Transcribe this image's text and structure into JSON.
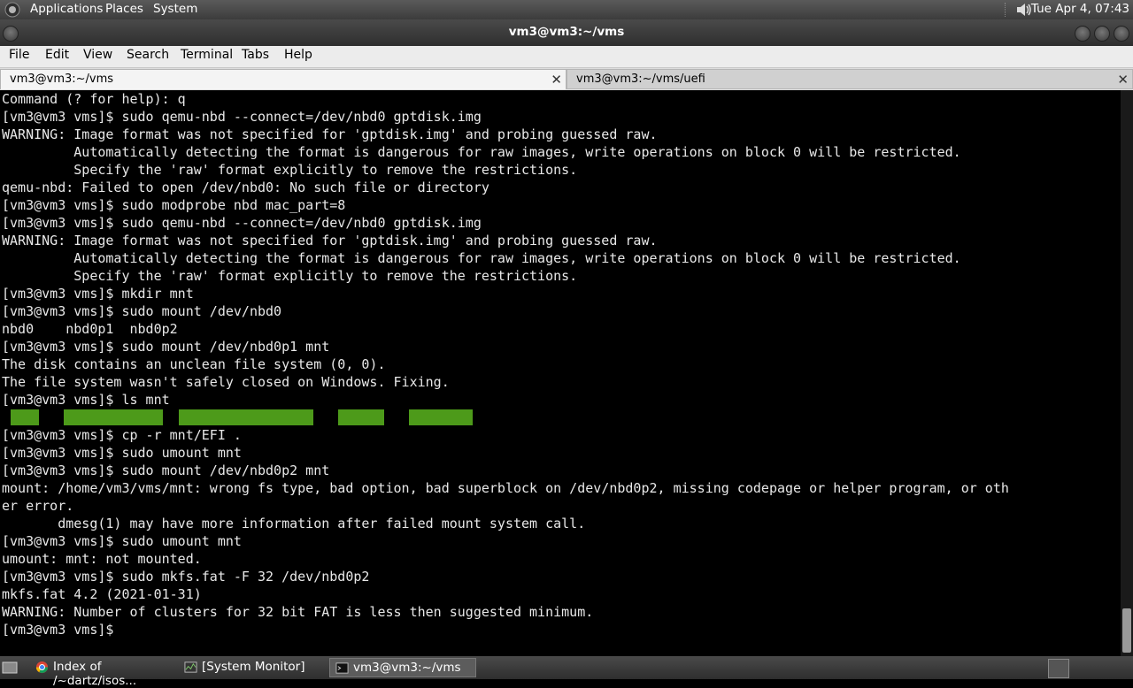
{
  "top_panel": {
    "menus": [
      "Applications",
      "Places",
      "System"
    ],
    "clock": "Tue Apr  4, 07:43"
  },
  "window": {
    "title": "vm3@vm3:~/vms",
    "menu": [
      "File",
      "Edit",
      "View",
      "Search",
      "Terminal",
      "Tabs",
      "Help"
    ]
  },
  "tabs": [
    {
      "label": "vm3@vm3:~/vms",
      "active": true
    },
    {
      "label": "vm3@vm3:~/vms/uefi",
      "active": false
    }
  ],
  "terminal": {
    "lines": [
      "Command (? for help): q",
      "[vm3@vm3 vms]$ sudo qemu-nbd --connect=/dev/nbd0 gptdisk.img",
      "WARNING: Image format was not specified for 'gptdisk.img' and probing guessed raw.",
      "         Automatically detecting the format is dangerous for raw images, write operations on block 0 will be restricted.",
      "         Specify the 'raw' format explicitly to remove the restrictions.",
      "qemu-nbd: Failed to open /dev/nbd0: No such file or directory",
      "[vm3@vm3 vms]$ sudo modprobe nbd mac_part=8",
      "[vm3@vm3 vms]$ sudo qemu-nbd --connect=/dev/nbd0 gptdisk.img",
      "WARNING: Image format was not specified for 'gptdisk.img' and probing guessed raw.",
      "         Automatically detecting the format is dangerous for raw images, write operations on block 0 will be restricted.",
      "         Specify the 'raw' format explicitly to remove the restrictions.",
      "[vm3@vm3 vms]$ mkdir mnt",
      "[vm3@vm3 vms]$ sudo mount /dev/nbd0",
      "nbd0    nbd0p1  nbd0p2",
      "[vm3@vm3 vms]$ sudo mount /dev/nbd0p1 mnt",
      "The disk contains an unclean file system (0, 0).",
      "The file system wasn't safely closed on Windows. Fixing.",
      "[vm3@vm3 vms]$ ls mnt",
      "",
      "[vm3@vm3 vms]$ cp -r mnt/EFI .",
      "[vm3@vm3 vms]$ sudo umount mnt",
      "[vm3@vm3 vms]$ sudo mount /dev/nbd0p2 mnt",
      "mount: /home/vm3/vms/mnt: wrong fs type, bad option, bad superblock on /dev/nbd0p2, missing codepage or helper program, or oth",
      "er error.",
      "       dmesg(1) may have more information after failed mount system call.",
      "[vm3@vm3 vms]$ sudo umount mnt",
      "umount: mnt: not mounted.",
      "[vm3@vm3 vms]$ sudo mkfs.fat -F 32 /dev/nbd0p2",
      "mkfs.fat 4.2 (2021-01-31)",
      "WARNING: Number of clusters for 32 bit FAT is less then suggested minimum.",
      "[vm3@vm3 vms]$ "
    ],
    "ls_highlight_color": "#4d9a1a"
  },
  "taskbar": {
    "items": [
      {
        "label": "Index of /~dartz/isos...",
        "icon": "chrome-icon"
      },
      {
        "label": "[System Monitor]",
        "icon": "system-monitor-icon"
      },
      {
        "label": "vm3@vm3:~/vms",
        "icon": "terminal-icon"
      }
    ]
  }
}
